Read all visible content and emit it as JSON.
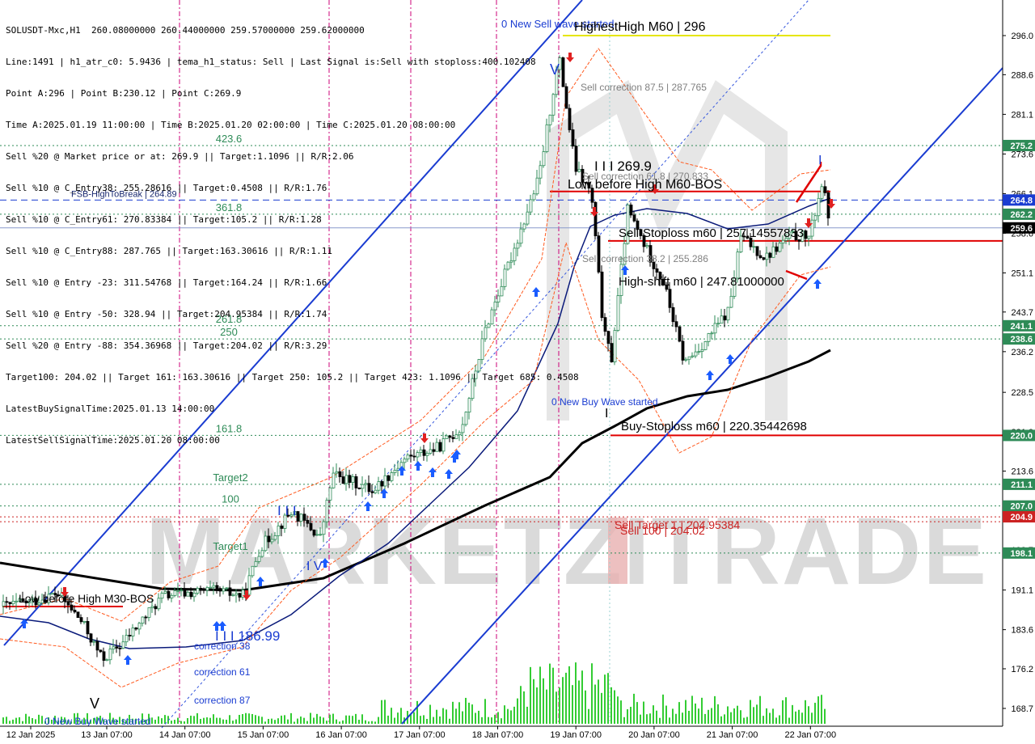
{
  "info_lines": [
    "SOLUSDT-Mxc,H1  260.08000000 260.44000000 259.57000000 259.62000000",
    "Line:1491 | h1_atr_c0: 5.9436 | tema_h1_status: Sell | Last Signal is:Sell with stoploss:400.102408",
    "Point A:296 | Point B:230.12 | Point C:269.9",
    "Time A:2025.01.19 11:00:00 | Time B:2025.01.20 02:00:00 | Time C:2025.01.20 08:00:00",
    "Sell %20 @ Market price or at: 269.9 || Target:1.1096 || R/R:2.06",
    "Sell %10 @ C_Entry38: 255.28616 || Target:0.4508 || R/R:1.76",
    "Sell %10 @ C_Entry61: 270.83384 || Target:105.2 || R/R:1.28",
    "Sell %10 @ C_Entry88: 287.765 || Target:163.30616 || R/R:1.11",
    "Sell %10 @ Entry -23: 311.54768 || Target:164.24 || R/R:1.66",
    "Sell %10 @ Entry -50: 328.94 || Target:204.95384 || R/R:1.74",
    "Sell %20 @ Entry -88: 354.36968 || Target:204.02 || R/R:3.29",
    "Target100: 204.02 || Target 161: 163.30616 || Target 250: 105.2 || Target 423: 1.1096 || Target 685: 0.4508",
    "LatestBuySignalTime:2025.01.13 14:00:00",
    "LatestSellSignalTime:2025.01.20 08:00:00"
  ],
  "chart_data": {
    "type": "candlestick",
    "symbol": "SOLUSDT-Mxc,H1",
    "ohlc_last": {
      "open": 260.08,
      "high": 260.44,
      "low": 259.57,
      "close": 259.62
    },
    "price_axis": {
      "ylim": [
        166.3,
        300.1
      ],
      "ticks": [
        "296.0",
        "288.6",
        "281.1",
        "273.6",
        "266.1",
        "258.6",
        "251.1",
        "243.7",
        "236.2",
        "228.5",
        "221.0",
        "213.6",
        "206.1",
        "198.7",
        "191.1",
        "183.6",
        "176.2",
        "168.7"
      ]
    },
    "time_axis": {
      "labels": [
        "12 Jan 2025",
        "13 Jan 07:00",
        "14 Jan 07:00",
        "15 Jan 07:00",
        "16 Jan 07:00",
        "17 Jan 07:00",
        "18 Jan 07:00",
        "19 Jan 07:00",
        "20 Jan 07:00",
        "21 Jan 07:00",
        "22 Jan 07:00"
      ]
    },
    "price_tags": [
      {
        "text": "275.2",
        "value": 275.2,
        "bg": "#2e8b57",
        "fg": "#ffffff"
      },
      {
        "text": "264.8",
        "value": 264.89,
        "bg": "#1a3cd1",
        "fg": "#ffffff"
      },
      {
        "text": "262.2",
        "value": 262.2,
        "bg": "#2e8b57",
        "fg": "#ffffff"
      },
      {
        "text": "259.6",
        "value": 259.62,
        "bg": "#000000",
        "fg": "#ffffff"
      },
      {
        "text": "241.1",
        "value": 241.1,
        "bg": "#2e8b57",
        "fg": "#ffffff"
      },
      {
        "text": "238.6",
        "value": 238.6,
        "bg": "#2e8b57",
        "fg": "#ffffff"
      },
      {
        "text": "220.0",
        "value": 220.35,
        "bg": "#2e8b57",
        "fg": "#ffffff"
      },
      {
        "text": "211.1",
        "value": 211.1,
        "bg": "#2e8b57",
        "fg": "#ffffff"
      },
      {
        "text": "207.0",
        "value": 207.0,
        "bg": "#2e8b57",
        "fg": "#ffffff"
      },
      {
        "text": "204.9",
        "value": 204.95,
        "bg": "#cc2222",
        "fg": "#ffffff"
      },
      {
        "text": "198.1",
        "value": 198.1,
        "bg": "#2e8b57",
        "fg": "#ffffff"
      }
    ],
    "horizontal_levels": [
      {
        "value": 296.0,
        "color": "#e6e600",
        "style": "solid",
        "label": ""
      },
      {
        "value": 275.2,
        "color": "#2e8b57",
        "style": "dotted",
        "label": "423.6"
      },
      {
        "value": 264.89,
        "color": "#1a3cd1",
        "style": "dashed",
        "label": "FSB-HighToBreak | 264.89"
      },
      {
        "value": 262.2,
        "color": "#2e8b57",
        "style": "dotted",
        "label": "361.8"
      },
      {
        "value": 259.62,
        "color": "#8899cc",
        "style": "solid",
        "label": ""
      },
      {
        "value": 241.1,
        "color": "#2e8b57",
        "style": "dotted",
        "label": "261.8"
      },
      {
        "value": 238.6,
        "color": "#2e8b57",
        "style": "dotted",
        "label": "250"
      },
      {
        "value": 220.35,
        "color": "#2e8b57",
        "style": "dotted",
        "label": "161.8"
      },
      {
        "value": 211.1,
        "color": "#2e8b57",
        "style": "dotted",
        "label": "Target2"
      },
      {
        "value": 207.0,
        "color": "#2e8b57",
        "style": "dotted",
        "label": "100"
      },
      {
        "value": 204.95,
        "color": "#cc2222",
        "style": "dotted",
        "label": ""
      },
      {
        "value": 204.02,
        "color": "#cc2222",
        "style": "dotted",
        "label": ""
      },
      {
        "value": 198.1,
        "color": "#2e8b57",
        "style": "dotted",
        "label": "Target1"
      }
    ],
    "annotations": [
      {
        "text": "0 New Sell wave started",
        "color": "#1a3cd1"
      },
      {
        "text": "HighestHigh   M60 | 296",
        "color": "#000000"
      },
      {
        "text": "Sell correction 87.5 | 287.765",
        "color": "#808080"
      },
      {
        "text": "I I I 269.9",
        "color": "#000000"
      },
      {
        "text": "Sell correction 61.8 | 270.833",
        "color": "#808080"
      },
      {
        "text": "Low before High   M60-BOS",
        "color": "#000000"
      },
      {
        "text": "Sell-Stoploss m60 | 257.14557833",
        "color": "#000000"
      },
      {
        "text": "Sell correction 38.2 | 255.286",
        "color": "#808080"
      },
      {
        "text": "High-shift m60 | 247.81000000",
        "color": "#000000"
      },
      {
        "text": "0 New Buy Wave started",
        "color": "#1a3cd1"
      },
      {
        "text": "Buy-Stoploss m60 | 220.35442698",
        "color": "#000000"
      },
      {
        "text": "Sell Target 1 | 204.95384",
        "color": "#cc2222"
      },
      {
        "text": "Sell 100 | 204.02",
        "color": "#cc2222"
      },
      {
        "text": "I I I",
        "color": "#1a3cd1"
      },
      {
        "text": "I V",
        "color": "#1a3cd1"
      },
      {
        "text": "I I I 186.99",
        "color": "#1a3cd1"
      },
      {
        "text": "correction 38",
        "color": "#1a3cd1"
      },
      {
        "text": "correction 61",
        "color": "#1a3cd1"
      },
      {
        "text": "correction 87",
        "color": "#1a3cd1"
      },
      {
        "text": "0 New Buy Wave started",
        "color": "#1a3cd1"
      },
      {
        "text": "Low before High   M30-BOS",
        "color": "#000000"
      },
      {
        "text": "V",
        "color": "#000000"
      },
      {
        "text": "V",
        "color": "#1a3cd1"
      },
      {
        "text": "I",
        "color": "#000000"
      },
      {
        "text": "I",
        "color": "#1a3cd1"
      }
    ],
    "watermark": "MARKETZITRADE",
    "colors": {
      "background": "#ffffff",
      "bull_candle": "#2e8b57",
      "bear_candle": "#000000",
      "channel": "#1a3cd1",
      "ma_blue": "#0a1a7a",
      "ma_black": "#000000",
      "envelope": "#ff5a1f",
      "volume": "#33cc33",
      "buy_arrow": "#1a5cff",
      "sell_arrow": "#e02020",
      "session_line": "#cc0077"
    }
  }
}
